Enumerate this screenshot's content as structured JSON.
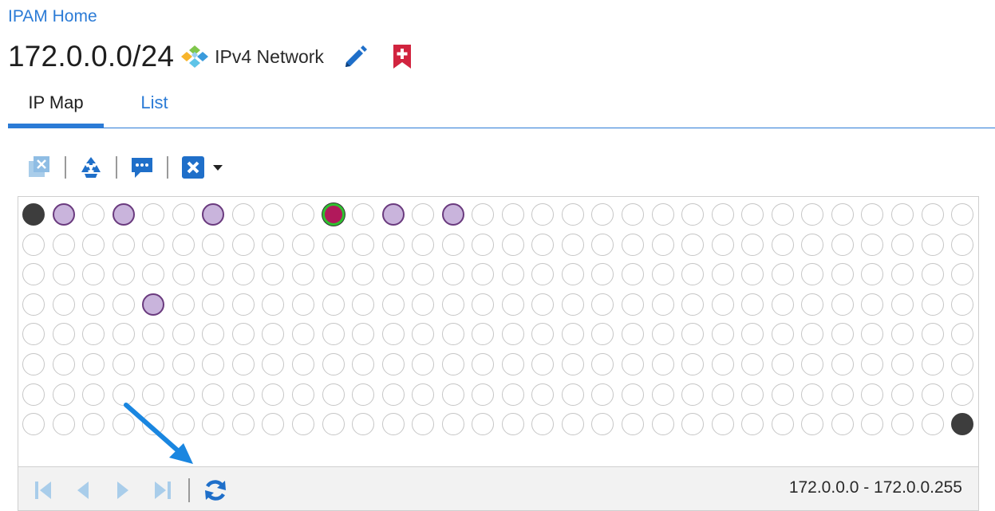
{
  "breadcrumb": {
    "home": "IPAM Home"
  },
  "header": {
    "title": "172.0.0.0/24",
    "network_type": "IPv4 Network"
  },
  "tabs": [
    {
      "label": "IP Map",
      "active": true
    },
    {
      "label": "List",
      "active": false
    }
  ],
  "toolbar": {
    "icons": [
      "clear-selection-icon",
      "reclaim-icon",
      "comment-icon",
      "delete-icon",
      "dropdown-caret-icon"
    ]
  },
  "ip_map": {
    "columns": 32,
    "rows": 8,
    "statuses": {
      "0": "reserved",
      "1": "used",
      "3": "used",
      "6": "used",
      "10": "selected",
      "12": "used",
      "14": "used",
      "100": "used",
      "255": "reserved"
    }
  },
  "footer": {
    "range": "172.0.0.0 - 172.0.0.255",
    "icons": [
      "first-page-icon",
      "prev-page-icon",
      "next-page-icon",
      "last-page-icon",
      "refresh-icon"
    ]
  },
  "colors": {
    "accent": "#2b7bd6",
    "used": "#c9b4dc",
    "reserved": "#3d3d3d",
    "selected": "#b1195b",
    "selected_ring": "#2fc12f",
    "bookmark": "#d1243f"
  }
}
